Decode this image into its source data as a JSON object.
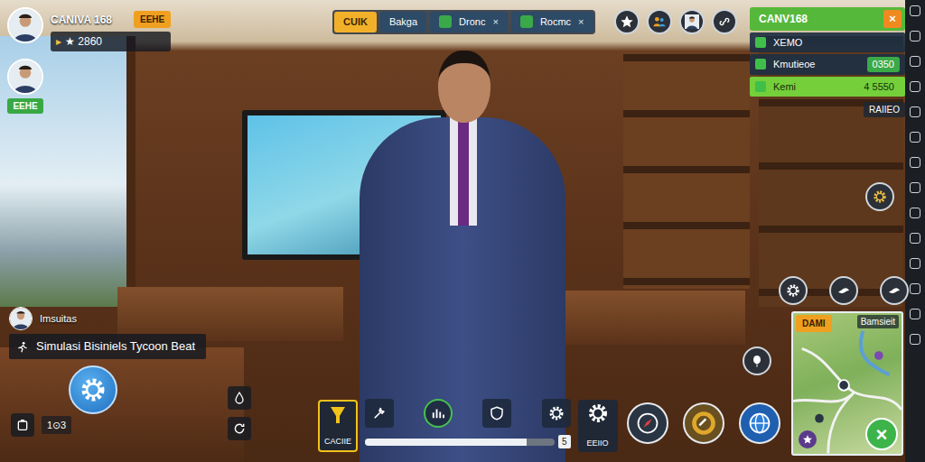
{
  "players": [
    {
      "name": "CANIVA 168",
      "badge": "EEHE",
      "arrow": "▸",
      "score": "★ 2860"
    },
    {
      "badge": "EEHE"
    }
  ],
  "tabs": [
    {
      "label": "CUIK",
      "selected": true
    },
    {
      "label": "Bakga",
      "selected": false
    },
    {
      "label": "Dronc",
      "close": "×",
      "selected": false
    },
    {
      "label": "Rocmc",
      "close": "×",
      "selected": false
    }
  ],
  "side_panel": {
    "title": "CANV168",
    "close": "×",
    "rows": [
      {
        "label": "XEMO",
        "selected": false
      },
      {
        "label": "Kmutieoe",
        "value": "0350",
        "selected": false
      },
      {
        "label": "Kemi",
        "value": "4 5550",
        "selected": true
      }
    ],
    "footer": "RAIIEO"
  },
  "chat": {
    "user": "Imsuitas",
    "banner": "Simulasi Bisiniels Tycoon Beat"
  },
  "counter": "1⊙3",
  "toolbar": {
    "left_label": "CACIIE",
    "right_label": "EEIIO",
    "progress": {
      "level": 0.85,
      "reading": "5"
    }
  },
  "minimap": {
    "badge": "DAMI",
    "label": "Bamsieit",
    "close": "×"
  }
}
